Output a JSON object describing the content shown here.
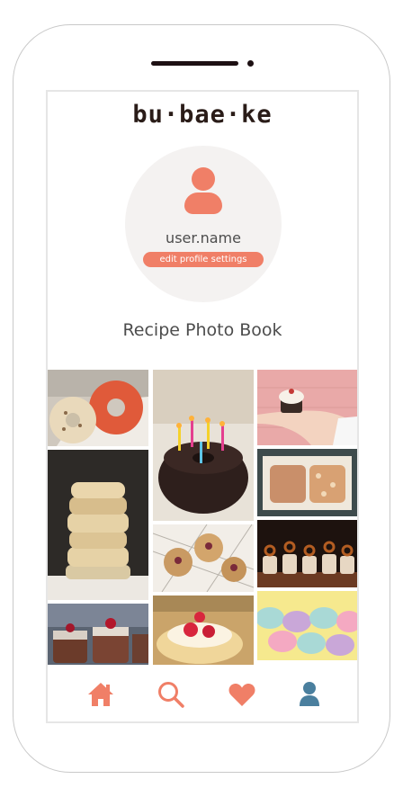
{
  "app": {
    "logo_text": "bu·bae·ke"
  },
  "profile": {
    "username": "user.name",
    "edit_label": "edit profile settings"
  },
  "book": {
    "title": "Recipe Photo Book"
  },
  "photos": [
    {
      "subject": "frosted donuts"
    },
    {
      "subject": "chocolate bundt cake with birthday candles"
    },
    {
      "subject": "cupcake held in hand"
    },
    {
      "subject": "stack of biscuits"
    },
    {
      "subject": "muffins on cooling rack"
    },
    {
      "subject": "loaf cakes on paper"
    },
    {
      "subject": "pretzel cupcakes"
    },
    {
      "subject": "chocolate mini cakes"
    },
    {
      "subject": "strawberry pastry"
    },
    {
      "subject": "pastel cupcakes"
    }
  ],
  "bottom_nav": {
    "items": [
      {
        "icon": "home-icon"
      },
      {
        "icon": "search-icon"
      },
      {
        "icon": "heart-icon"
      },
      {
        "icon": "profile-icon",
        "active": true
      }
    ]
  },
  "colors": {
    "accent": "#f07f67",
    "active_icon": "#4a7f9e",
    "profile_bg": "#f4f2f1"
  }
}
